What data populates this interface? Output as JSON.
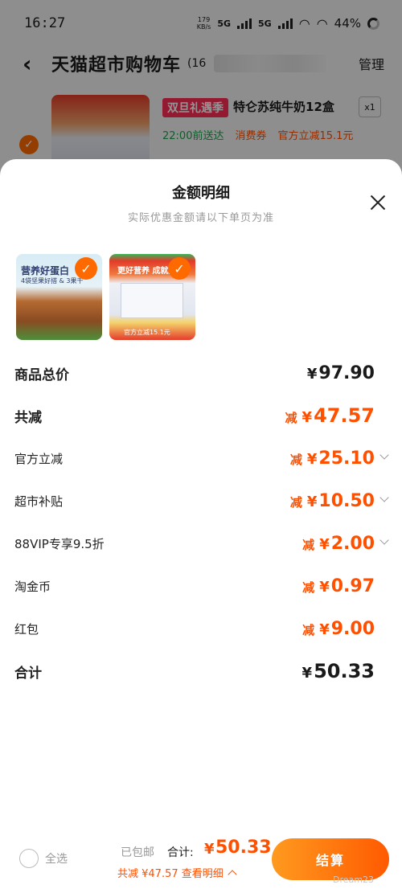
{
  "status_bar": {
    "time": "16:27",
    "speed": "179",
    "speed_unit": "KB/s",
    "net1": "5G",
    "net2": "5G",
    "battery": "44%"
  },
  "cart": {
    "title": "天猫超市购物车",
    "count": "(16",
    "manage": "管理",
    "item": {
      "tag": "双旦礼遇季",
      "name": "特仑苏纯牛奶12盒",
      "qty": "x1",
      "delivery": "22:00前送达",
      "coupon": "消费券",
      "discount": "官方立减15.1元"
    }
  },
  "sheet": {
    "title": "金额明细",
    "subtitle": "实际优惠金额请以下单页为准",
    "thumbnails": [
      {
        "caption": "营养好蛋白",
        "caption2": "4袋坚果好搭 & 3果干"
      },
      {
        "caption": "更好营养 成就更好",
        "footer": "官方立减15.1元"
      }
    ],
    "rows": [
      {
        "label": "商品总价",
        "prefix": "",
        "yen": "¥",
        "amount": "97.90"
      },
      {
        "label": "共减",
        "prefix": "减",
        "yen": "¥",
        "amount": "47.57"
      },
      {
        "label": "官方立减",
        "prefix": "减",
        "yen": "¥",
        "amount": "25.10"
      },
      {
        "label": "超市补贴",
        "prefix": "减",
        "yen": "¥",
        "amount": "10.50"
      },
      {
        "label": "88VIP专享9.5折",
        "prefix": "减",
        "yen": "¥",
        "amount": "2.00"
      },
      {
        "label": "淘金币",
        "prefix": "减",
        "yen": "¥",
        "amount": "0.97"
      },
      {
        "label": "红包",
        "prefix": "减",
        "yen": "¥",
        "amount": "9.00"
      },
      {
        "label": "合计",
        "prefix": "",
        "yen": "¥",
        "amount": "50.33"
      }
    ]
  },
  "bottom_bar": {
    "select_all": "全选",
    "shipping": "已包邮",
    "total_label": "合计:",
    "total_yen": "¥",
    "total_value": "50.33",
    "reduce_text": "共减 ¥47.57 查看明细",
    "checkout": "结算"
  },
  "watermark": "Dream23",
  "colors": {
    "accent": "#ff5000",
    "check": "#ff6a00"
  }
}
